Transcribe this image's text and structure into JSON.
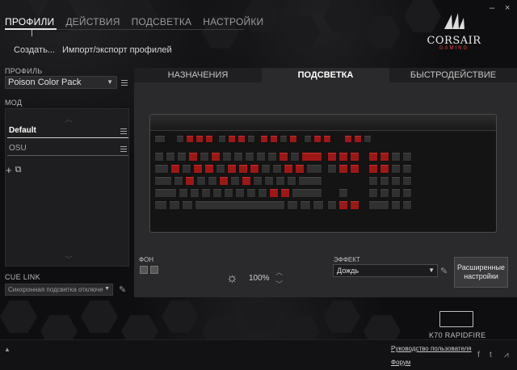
{
  "window": {
    "controls": {
      "minimize": "–",
      "close": "×"
    }
  },
  "brand": {
    "name": "CORSAIR",
    "tagline": "GAMING"
  },
  "topnav": {
    "tabs": [
      {
        "label": "ПРОФИЛИ",
        "active": true
      },
      {
        "label": "ДЕЙСТВИЯ",
        "active": false
      },
      {
        "label": "ПОДСВЕТКА",
        "active": false
      },
      {
        "label": "НАСТРОЙКИ",
        "active": false
      }
    ],
    "sub": {
      "create": "Создать...",
      "import_export": "Импорт/экспорт профилей"
    }
  },
  "left": {
    "profile_label": "ПРОФИЛЬ",
    "profile_value": "Poison Color Pack",
    "mode_label": "МОД",
    "modes": [
      {
        "label": "Default",
        "selected": true
      },
      {
        "label": "OSU",
        "selected": false
      }
    ],
    "tools": {
      "add": "+",
      "copy": "⧉"
    },
    "cue_label": "CUE LINK",
    "cue_value": "Синхронная подсветка отключе"
  },
  "main": {
    "tabs": [
      {
        "label": "НАЗНАЧЕНИЯ",
        "active": false
      },
      {
        "label": "ПОДСВЕТКА",
        "active": true
      },
      {
        "label": "БЫСТРОДЕЙСТВИЕ",
        "active": false
      }
    ],
    "background_label": "ФОН",
    "brightness": "100%",
    "effect_label": "ЭФФЕКТ",
    "effect_value": "Дождь",
    "advanced_button": "Расширенные настройки",
    "accent_red": "#9e1717"
  },
  "device": {
    "name": "K70 RAPIDFIRE"
  },
  "footer": {
    "guide": "Руководство пользователя",
    "forum": "Форум"
  },
  "icons": [
    "corsair-sails-icon",
    "menu-icon",
    "add-icon",
    "copy-icon",
    "pencil-icon",
    "sun-icon",
    "chevron-up-icon",
    "chevron-down-icon",
    "facebook-icon",
    "twitter-icon",
    "corsair-icon"
  ]
}
